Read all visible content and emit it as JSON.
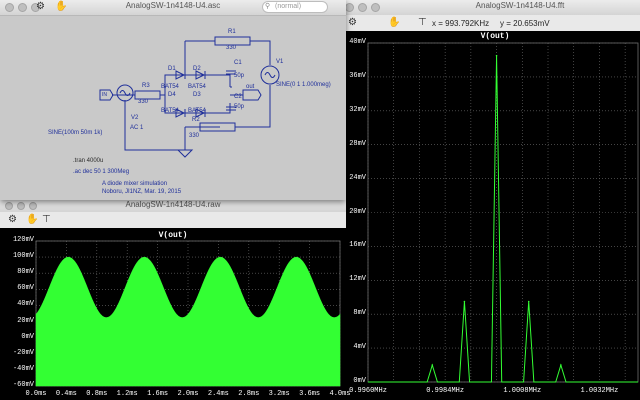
{
  "colors": {
    "trace": "#33ff33",
    "plot_bg": "#000000",
    "grid": "#6e6e6e",
    "wire": "#1f2f9a"
  },
  "fft_window": {
    "title": "AnalogSW-1n4148-U4.fft",
    "cursor_x": "x = 993.792KHz",
    "cursor_y": "y = 20.653mV",
    "icons": [
      "wrench-icon",
      "pan-icon",
      "cursor-icon"
    ]
  },
  "schematic_window": {
    "title": "AnalogSW-1n4148-U4.asc",
    "search_placeholder": "(normal)",
    "labels": {
      "r1": "R1",
      "r1_val": "330",
      "r2": "R2",
      "r2_val": "330",
      "r3": "R3",
      "r3_val": "330",
      "c1": "C1",
      "c1_val": "50p",
      "c2": "C2",
      "c2_val": "50p",
      "d1": "D1",
      "d2": "D2",
      "d3": "D3",
      "d4": "D4",
      "d1_model": "BAT54",
      "d2_model": "BAT54",
      "d3_model": "BAT54",
      "d4_model": "BAT54",
      "v1": "V1",
      "v1_val": "SINE(0 1 1.000meg)",
      "v2": "V2",
      "v2_ac": "AC 1",
      "v2_val": "SINE(100m 50m 1k)",
      "in_label": "IN",
      "out_label": "out",
      "tran": ".tran 4000u",
      "ac": ".ac dec 50 1 300Meg",
      "note1": "A diode mixer simulation",
      "note2": "Noboru, JI1NZ, Mar. 19, 2015"
    }
  },
  "raw_window": {
    "title": "AnalogSW-1n4148-U4.raw"
  },
  "time_plot": {
    "title": "V(out)",
    "y_ticks": [
      "120mV",
      "100mV",
      "80mV",
      "60mV",
      "40mV",
      "20mV",
      "0mV",
      "-20mV",
      "-40mV",
      "-60mV"
    ],
    "x_ticks": [
      "0.0ms",
      "0.4ms",
      "0.8ms",
      "1.2ms",
      "1.6ms",
      "2.0ms",
      "2.4ms",
      "2.8ms",
      "3.2ms",
      "3.6ms",
      "4.0ms"
    ]
  },
  "fft_plot": {
    "title": "V(out)",
    "y_ticks": [
      "40mV",
      "36mV",
      "32mV",
      "28mV",
      "24mV",
      "20mV",
      "16mV",
      "12mV",
      "8mV",
      "4mV",
      "0mV"
    ],
    "x_ticks": [
      "0.9960MHz",
      "0.9984MHz",
      "1.0008MHz",
      "1.0032MHz"
    ]
  },
  "chart_data": [
    {
      "type": "area",
      "title": "V(out)",
      "x_unit": "ms",
      "y_unit": "mV",
      "xlim": [
        0,
        4.0
      ],
      "ylim": [
        -60,
        120
      ],
      "envelope": {
        "frequency_khz": 1,
        "upper_min": 25,
        "upper_max": 100,
        "lower": -60
      }
    },
    {
      "type": "line",
      "title": "V(out)",
      "x_unit": "MHz",
      "y_unit": "mV",
      "xlim": [
        0.996,
        1.0044
      ],
      "ylim": [
        0,
        40
      ],
      "peaks": [
        {
          "x": 0.998,
          "y": 2
        },
        {
          "x": 0.999,
          "y": 9.5
        },
        {
          "x": 1.0,
          "y": 38.5
        },
        {
          "x": 1.001,
          "y": 9.5
        },
        {
          "x": 1.002,
          "y": 2
        }
      ]
    }
  ]
}
